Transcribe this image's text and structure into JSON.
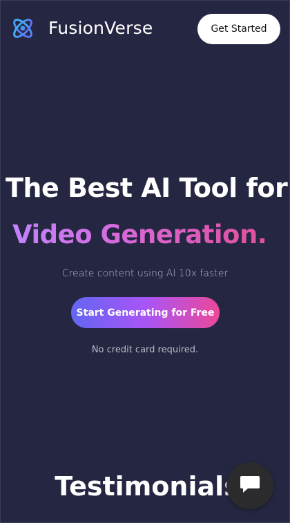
{
  "header": {
    "brand": "FusionVerse",
    "logo_icon": "atom-orbit-icon",
    "get_started_label": "Get Started"
  },
  "hero": {
    "title_line1": "The Best AI Tool for",
    "title_line2": "Video Generation.",
    "subtitle": "Create content using AI 10x faster",
    "cta_label": "Start Generating for Free",
    "note": "No credit card required."
  },
  "sections": {
    "testimonials_heading": "Testimonials"
  },
  "chat": {
    "icon": "chat-bubble-icon"
  },
  "colors": {
    "background": "#252742",
    "accent_gradient_start": "#6366f1",
    "accent_gradient_mid": "#a855f7",
    "accent_gradient_end": "#ec4899",
    "title_gradient_start": "#c084fc",
    "title_gradient_end": "#e0509a",
    "logo_blue": "#3b82f6"
  }
}
